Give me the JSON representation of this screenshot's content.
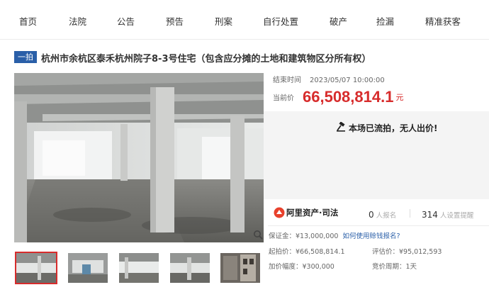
{
  "nav": {
    "items": [
      "首页",
      "法院",
      "公告",
      "预告",
      "刑案",
      "自行处置",
      "破产",
      "捡漏",
      "精准获客"
    ]
  },
  "title": {
    "tag": "一拍",
    "text": "杭州市余杭区泰禾杭州院子8-3号住宅（包含应分摊的土地和建筑物区分所有权）"
  },
  "auction": {
    "end_label": "结束时间",
    "end_value": "2023/05/07 10:00:00",
    "price_label": "当前价",
    "price_value": "66,508,814.1",
    "price_unit": "元",
    "status": "本场已流拍，无人出价!"
  },
  "platform": {
    "name": "阿里资产·司法",
    "signups": "0",
    "signups_label": "人报名",
    "reminders": "314",
    "reminders_label": "人设置提醒"
  },
  "details": {
    "deposit": "保证金：¥13,000,000",
    "deposit_link": "如何使用赊钱报名?",
    "start_price": "起拍价：¥66,508,814.1",
    "appraisal": "评估价：¥95,012,593",
    "increment": "加价幅度：¥300,000",
    "period": "竞价周期：1天"
  },
  "colors": {
    "accent_red": "#d72c2c",
    "tag_blue": "#2a5fa8",
    "status_bg": "#f4f4f4"
  },
  "icons": [
    "zoom-icon",
    "hammer-icon",
    "ali-asset-logo-icon"
  ]
}
